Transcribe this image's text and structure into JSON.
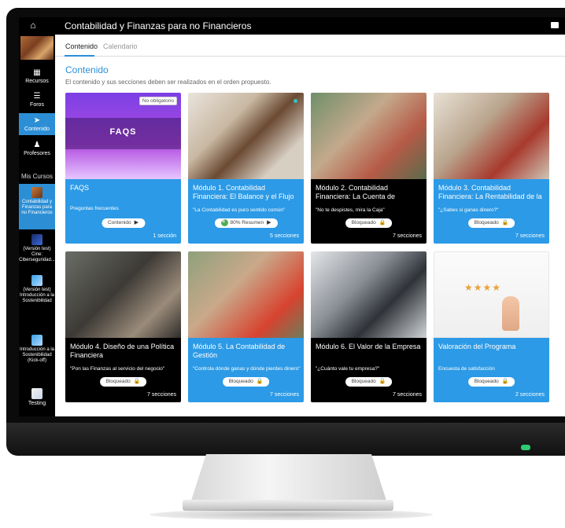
{
  "app": {
    "title": "Contabilidad y Finanzas para no Financieros"
  },
  "sidebar": {
    "items": [
      {
        "label": "Recursos",
        "icon": "book-icon"
      },
      {
        "label": "Foros",
        "icon": "list-icon"
      },
      {
        "label": "Contenido",
        "icon": "navigation-arrow-icon"
      },
      {
        "label": "Profesores",
        "icon": "person-icon"
      }
    ],
    "my_courses_label": "Mis Cursos",
    "courses": [
      {
        "label": "Contabilidad y Finanzas para no Financieros"
      },
      {
        "label": "(Versión test) Cine: Ciberseguridad..."
      },
      {
        "label": "(Versión test) Introducción a la Sostenibilidad"
      },
      {
        "label": "Introducción a la Sostenibilidad (Kick-off)"
      },
      {
        "label": "Testing"
      }
    ]
  },
  "tabs": [
    {
      "label": "Contenido"
    },
    {
      "label": "Calendario"
    }
  ],
  "section": {
    "title": "Contenido",
    "note": "El contenido y sus secciones deben ser realizados en el orden propuesto."
  },
  "cards": [
    {
      "title": "FAQS",
      "subtitle": "Preguntas frecuentes",
      "button": "Contenido",
      "count": "1 sección",
      "badge": "No obligatorio",
      "image_text": "FAQS"
    },
    {
      "title": "Módulo 1. Contabilidad Financiera: El Balance y el Flujo",
      "subtitle": "\"La Contabilidad es puro sentido común\"",
      "button": "80% Resumen",
      "count": "5 secciones",
      "progress": 0.8
    },
    {
      "title": "Módulo 2. Contabilidad Financiera: La Cuenta de",
      "subtitle": "\"No te despistes, mira la Caja\"",
      "button": "Bloqueado",
      "count": "7 secciones"
    },
    {
      "title": "Módulo 3. Contabilidad Financiera: La Rentabilidad de la",
      "subtitle": "\"¿Sabes si ganas dinero?\"",
      "button": "Bloqueado",
      "count": "7 secciones"
    },
    {
      "title": "Módulo 4. Diseño de una Política Financiera",
      "subtitle": "\"Pon las Finanzas al servicio del negocio\"",
      "button": "Bloqueado",
      "count": "7 secciones"
    },
    {
      "title": "Módulo 5. La Contabilidad de Gestión",
      "subtitle": "\"Controla dónde ganas y dónde pierdes dinero\"",
      "button": "Bloqueado",
      "count": "7 secciones"
    },
    {
      "title": "Módulo 6. El Valor de la Empresa",
      "subtitle": "\"¿Cuánto vale tu empresa?\"",
      "button": "Bloqueado",
      "count": "7 secciones"
    },
    {
      "title": "Valoración del Programa",
      "subtitle": "Encuesta de satisfacción",
      "button": "Bloqueado",
      "count": "2 secciones",
      "rating_stars": 4
    }
  ],
  "colors": {
    "accent": "#2c8fd6",
    "card_blue": "#2c9ae6",
    "card_black": "#000000",
    "progress_green": "#4caf50"
  }
}
